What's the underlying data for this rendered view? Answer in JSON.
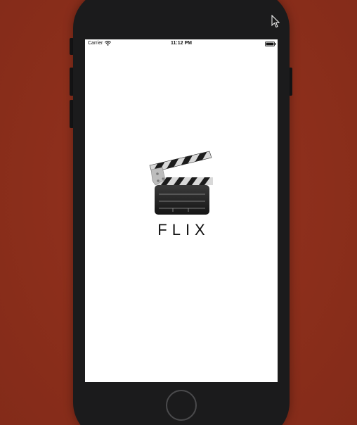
{
  "status_bar": {
    "carrier": "Carrier",
    "time": "11:12 PM",
    "icons": [
      "wifi-icon",
      "battery-icon"
    ]
  },
  "splash": {
    "logo_icon": "clapperboard-icon",
    "app_name": "FLIX"
  },
  "device": {
    "home_button": "home-button",
    "body_color": "#1b1b1c",
    "background_color": "#8e2f1c"
  }
}
